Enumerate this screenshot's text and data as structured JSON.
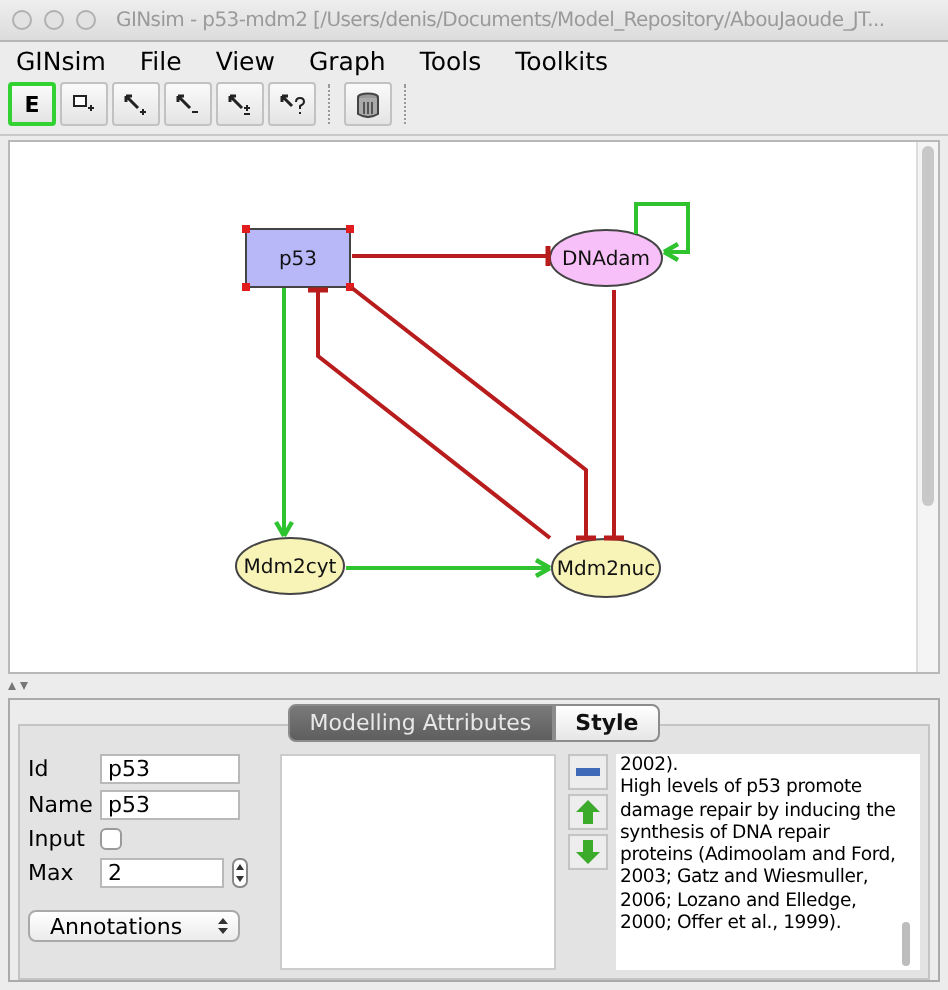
{
  "window": {
    "title": "GINsim - p53-mdm2 [/Users/denis/Documents/Model_Repository/AbouJaoude_JT..."
  },
  "menu": [
    "GINsim",
    "File",
    "View",
    "Graph",
    "Tools",
    "Toolkits"
  ],
  "toolbar": [
    {
      "kind": "edit",
      "label": "E",
      "selected": true
    },
    {
      "kind": "add-node",
      "selected": false
    },
    {
      "kind": "add-positive",
      "selected": false
    },
    {
      "kind": "add-negative",
      "selected": false
    },
    {
      "kind": "add-dual",
      "selected": false
    },
    {
      "kind": "add-unknown",
      "selected": false
    },
    {
      "kind": "delete",
      "selected": false
    }
  ],
  "graph": {
    "nodes": [
      {
        "label": "p53",
        "kind": "rectangle",
        "color": "#b8b8f8",
        "selected": true
      },
      {
        "label": "DNAdam",
        "kind": "ellipse",
        "color": "#f8c0f8",
        "selected": false
      },
      {
        "label": "Mdm2cyt",
        "kind": "ellipse",
        "color": "#f8f4b8",
        "selected": false
      },
      {
        "label": "Mdm2nuc",
        "kind": "ellipse",
        "color": "#f8f4b8",
        "selected": false
      }
    ],
    "edges": [
      {
        "kind": "inhibition"
      },
      {
        "kind": "activation"
      },
      {
        "kind": "inhibition"
      },
      {
        "kind": "inhibition"
      },
      {
        "kind": "inhibition"
      },
      {
        "kind": "activation"
      },
      {
        "kind": "activation"
      }
    ]
  },
  "panel": {
    "tabs": [
      {
        "label": "Modelling Attributes",
        "selected": true
      },
      {
        "label": "Style",
        "selected": false
      }
    ],
    "id": {
      "label": "Id",
      "value": "p53"
    },
    "name": {
      "label": "Name",
      "value": "p53"
    },
    "input": {
      "label": "Input",
      "checked": false
    },
    "max": {
      "label": "Max",
      "value": "2"
    },
    "annotations": "Annotations",
    "notes": "2002).\nHigh levels of p53 promote damage repair by inducing the synthesis of DNA repair proteins (Adimoolam and Ford, 2003; Gatz and Wiesmuller, 2006; Lozano and Elledge, 2000; Offer et al., 1999)."
  }
}
